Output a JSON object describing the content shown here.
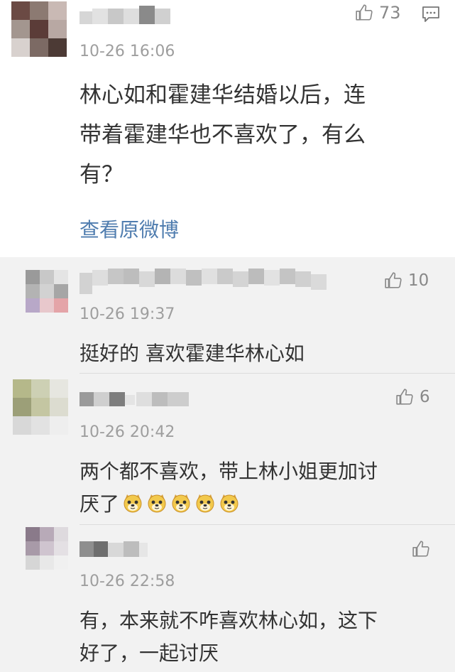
{
  "post": {
    "time": "10-26 16:06",
    "text_lines": [
      "林心如和霍建华结婚以后，连",
      "带着霍建华也不喜欢了，有么",
      "有？"
    ],
    "view_original_label": "查看原微博",
    "like_count": "73",
    "avatar_colors": [
      "#6b4a44",
      "#8c7a72",
      "#c9b9b4",
      "#a3968f",
      "#5b3c38",
      "#b8a8a3",
      "#d8d1ce",
      "#7c6a64",
      "#4c3a35"
    ]
  },
  "replies": [
    {
      "time": "10-26 19:37",
      "text_lines": [
        "挺好的 喜欢霍建华林心如"
      ],
      "like_count": "10",
      "avatar_colors": [
        "#9a9a9a",
        "#c8c8c8",
        "#e4e4e4",
        "#b3b3b3",
        "#d2d2d2",
        "#a6a6a6",
        "#b8a8c8",
        "#e8c8cc",
        "#e4a4a8"
      ]
    },
    {
      "time": "10-26 20:42",
      "text_lines": [
        "两个都不喜欢，带上林小姐更加讨",
        "厌了"
      ],
      "emoji_count": 5,
      "emoji_name": "doge-emoji",
      "like_count": "6",
      "avatar_colors": [
        "#b5b88a",
        "#cdd0b4",
        "#e6e6e0",
        "#9c9f78",
        "#c4c6a2",
        "#dcdcd0",
        "#d8d8d8",
        "#e2e2e2",
        "#eeeeee"
      ]
    },
    {
      "time": "10-26 22:58",
      "text_lines": [
        "有，本来就不咋喜欢林心如，这下",
        "好了，一起讨厌"
      ],
      "like_count": "",
      "avatar_colors": [
        "#8a7a8a",
        "#b8aab8",
        "#dedade",
        "#a89aa8",
        "#cfc4cf",
        "#e4e0e4",
        "#d6d6d6",
        "#e8e8e8",
        "#f0f0f0"
      ]
    }
  ],
  "icons": {
    "like": "thumbs-up-icon",
    "comment": "comment-icon"
  }
}
